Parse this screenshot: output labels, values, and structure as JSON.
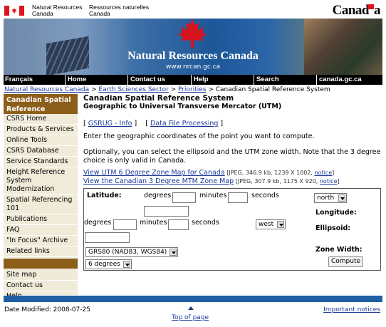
{
  "fip": {
    "dept_en_1": "Natural Resources",
    "dept_en_2": "Canada",
    "dept_fr_1": "Ressources naturelles",
    "dept_fr_2": "Canada",
    "wordmark": "Canad",
    "wordmark_end": "a"
  },
  "banner": {
    "title": "Natural Resources Canada",
    "url": "www.nrcan.gc.ca"
  },
  "nav": {
    "francais": "Français",
    "home": "Home",
    "contact": "Contact us",
    "help": "Help",
    "search": "Search",
    "canada": "canada.gc.ca"
  },
  "breadcrumb": {
    "nrc": "Natural Resources Canada",
    "sep1": " > ",
    "ess": "Earth Sciences Sector",
    "sep2": " > ",
    "priorities": "Priorities",
    "sep3": " > ",
    "current": "Canadian Spatial Reference System"
  },
  "leftnav": {
    "heading": "Canadian Spatial Reference System",
    "items": [
      "CSRS Home",
      "Products & Services",
      "Online Tools",
      "CSRS Database",
      "Service Standards",
      "Height Reference System Modernization",
      "Spatial Referencing 101",
      "Publications",
      "FAQ",
      "\"In Focus\" Archive",
      "Related links"
    ],
    "bottom": [
      "Site map",
      "Contact us",
      "Help"
    ]
  },
  "main": {
    "title": "Canadian Spatial Reference System",
    "subtitle": "Geographic to Universal Transverse Mercator (UTM)",
    "tool1": "GSRUG - Info",
    "tool2": "Data File Processing",
    "intro": "Enter the geographic coordinates of the point you want to compute.",
    "optional": "Optionally, you can select the ellipsoid and the UTM zone width. Note that the 3 degree choice is only valid in Canada.",
    "map1": "View UTM 6 Degree Zone Map for Canada",
    "map1_meta": " [JPEG, 346.9 kb, 1239 X 1002, ",
    "map2": "View the Canadian 3 Degree MTM Zone Map",
    "map2_meta": " [JPEG, 307.9 kb, 1175 X 920, ",
    "notice": "notice",
    "close": "]"
  },
  "form": {
    "latitude": "Latitude:",
    "degrees": "degrees",
    "minutes": "minutes",
    "seconds": "seconds",
    "hemi_ns": "north",
    "longitude": "Longitude:",
    "hemi_ew": "west",
    "ellipsoid_label": "Ellipsoid:",
    "ellipsoid": "GRS80 (NAD83, WGS84)",
    "zone_label": "Zone Width:",
    "zone": "6 degrees",
    "compute": "Compute"
  },
  "footer": {
    "modified": "Date Modified: 2008-07-25",
    "top": "Top of page",
    "notices": "Important notices"
  },
  "colors": {
    "nav_bg": "#000000",
    "sidebar_head": "#8b5e1a",
    "sidebar_bg": "#f0ead9",
    "link": "#1a3a9c",
    "footer_bar": "#1f5fa3"
  }
}
